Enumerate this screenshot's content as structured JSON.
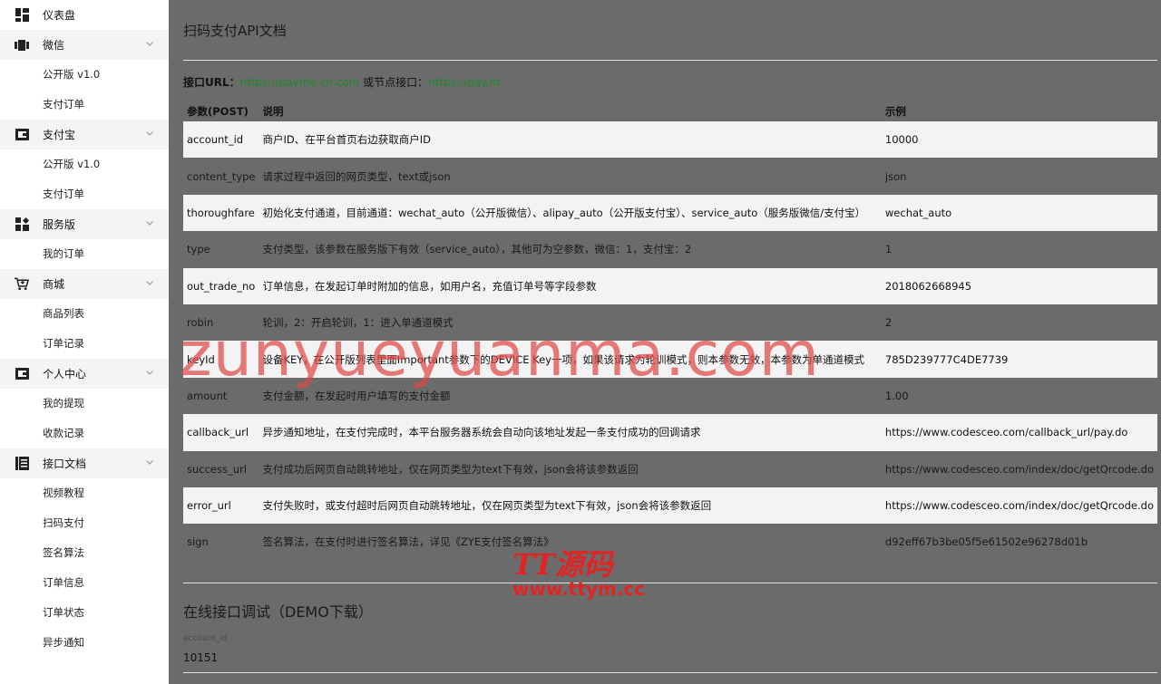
{
  "sidebar": {
    "groups": [
      {
        "label": "仪表盘",
        "icon": "dashboard-icon",
        "items": []
      },
      {
        "label": "微信",
        "icon": "wechat-icon",
        "items": [
          "公开版 v1.0",
          "支付订单"
        ]
      },
      {
        "label": "支付宝",
        "icon": "alipay-icon",
        "items": [
          "公开版 v1.0",
          "支付订单"
        ]
      },
      {
        "label": "服务版",
        "icon": "apps-icon",
        "items": [
          "我的订单"
        ]
      },
      {
        "label": "商城",
        "icon": "cart-icon",
        "items": [
          "商品列表",
          "订单记录"
        ]
      },
      {
        "label": "个人中心",
        "icon": "user-center-icon",
        "items": [
          "我的提现",
          "收款记录"
        ]
      },
      {
        "label": "接口文档",
        "icon": "doc-icon",
        "items": [
          "视频教程",
          "扫码支付",
          "签名算法",
          "订单信息",
          "订单状态",
          "异步通知"
        ]
      }
    ]
  },
  "main": {
    "title": "扫码支付API文档",
    "url_label": "接口URL：",
    "url_value": "https://payme.cn.com",
    "node_label": " 或节点接口：",
    "node_value": "https://pay.ht",
    "table": {
      "headers": [
        "参数(POST)",
        "说明",
        "示例"
      ],
      "rows": [
        {
          "param": "account_id",
          "desc": "商户ID、在平台首页右边获取商户ID",
          "example": "10000"
        },
        {
          "param": "content_type",
          "desc": "请求过程中返回的网页类型，text或json",
          "example": "json"
        },
        {
          "param": "thoroughfare",
          "desc": "初始化支付通道，目前通道：wechat_auto（公开版微信）、alipay_auto（公开版支付宝）、service_auto（服务版微信/支付宝）",
          "example": "wechat_auto"
        },
        {
          "param": "type",
          "desc": "支付类型，该参数在服务版下有效（service_auto），其他可为空参数，微信：1，支付宝：2",
          "example": "1"
        },
        {
          "param": "out_trade_no",
          "desc": "订单信息，在发起订单时附加的信息，如用户名，充值订单号等字段参数",
          "example": "2018062668945"
        },
        {
          "param": "robin",
          "desc": "轮训，2：开启轮训，1：进入单通道模式",
          "example": "2"
        },
        {
          "param": "keyId",
          "desc": "设备KEY，在公开版列表里面Important参数下的DEVICE Key一项，如果该请求为轮训模式，则本参数无效，本参数为单通道模式",
          "example": "785D239777C4DE7739"
        },
        {
          "param": "amount",
          "desc": "支付金额，在发起时用户填写的支付金额",
          "example": "1.00"
        },
        {
          "param": "callback_url",
          "desc": "异步通知地址，在支付完成时，本平台服务器系统会自动向该地址发起一条支付成功的回调请求",
          "example": "https://www.codesceo.com/callback_url/pay.do"
        },
        {
          "param": "success_url",
          "desc": "支付成功后网页自动跳转地址，仅在网页类型为text下有效，json会将该参数返回",
          "example": "https://www.codesceo.com/index/doc/getQrcode.do"
        },
        {
          "param": "error_url",
          "desc": "支付失败时，或支付超时后网页自动跳转地址，仅在网页类型为text下有效，json会将该参数返回",
          "example": "https://www.codesceo.com/index/doc/getQrcode.do"
        },
        {
          "param": "sign",
          "desc": "签名算法，在支付时进行签名算法，详见《ZYE支付签名算法》",
          "example": "d92eff67b3be05f5e61502e96278d01b"
        }
      ]
    },
    "demo_title": "在线接口调试（DEMO下载）",
    "field_label": "account_id",
    "field_value": "10151"
  },
  "watermark": {
    "big": "zunyueyuanma.com",
    "cn": "TT源码",
    "url": "www.ttym.cc"
  }
}
